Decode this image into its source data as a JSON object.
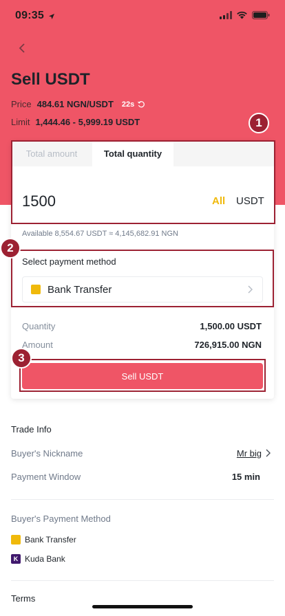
{
  "status_bar": {
    "time": "09:35"
  },
  "header": {
    "title": "Sell USDT",
    "price_label": "Price",
    "price_value": "484.61 NGN/USDT",
    "timer": "22s",
    "limit_label": "Limit",
    "limit_value": "1,444.46 - 5,999.19 USDT"
  },
  "tabs": [
    {
      "label": "Total amount",
      "active": false
    },
    {
      "label": "Total quantity",
      "active": true
    }
  ],
  "quantity_input": {
    "value": "1500",
    "all_label": "All",
    "unit": "USDT"
  },
  "available_text": "Available 8,554.67 USDT ≈ 4,145,682.91 NGN",
  "payment": {
    "label": "Select payment method",
    "selected": "Bank Transfer"
  },
  "summary": {
    "quantity_label": "Quantity",
    "quantity_value": "1,500.00 USDT",
    "amount_label": "Amount",
    "amount_value": "726,915.00 NGN"
  },
  "sell_button": "Sell USDT",
  "markers": [
    "1",
    "2",
    "3"
  ],
  "trade_info": {
    "title": "Trade Info",
    "nickname_label": "Buyer's Nickname",
    "nickname_value": "Mr big",
    "window_label": "Payment Window",
    "window_value": "15 min"
  },
  "buyer_methods": {
    "title": "Buyer's Payment Method",
    "items": [
      "Bank Transfer",
      "Kuda Bank"
    ]
  },
  "terms_label": "Terms",
  "colors": {
    "hero": "#ef5566",
    "accent": "#f0b90b",
    "marker": "#9c2132",
    "sell_button": "#ef5566"
  }
}
